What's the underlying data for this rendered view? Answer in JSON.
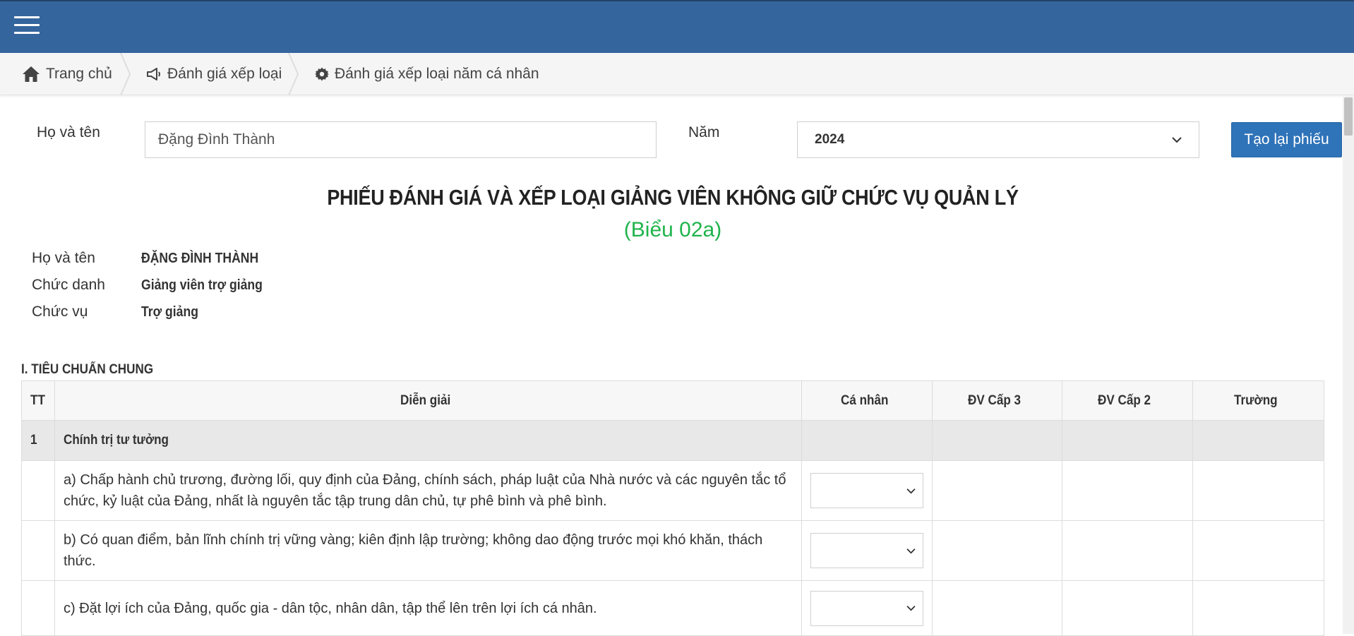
{
  "breadcrumb": {
    "home": "Trang chủ",
    "evaluation": "Đánh giá xếp loại",
    "current": "Đánh giá xếp loại năm cá nhân"
  },
  "form": {
    "name_label": "Họ và tên",
    "name_value": "Đặng Đình Thành",
    "year_label": "Năm",
    "year_value": "2024",
    "regenerate_label": "Tạo lại phiếu"
  },
  "sheet": {
    "title": "PHIẾU ĐÁNH GIÁ VÀ XẾP LOẠI GIẢNG VIÊN KHÔNG GIỮ CHỨC VỤ QUẢN LÝ",
    "subtitle": "(Biểu 02a)",
    "info": [
      {
        "label": "Họ và tên",
        "value": "ĐẶNG ĐÌNH THÀNH"
      },
      {
        "label": "Chức danh",
        "value": "Giảng viên trợ giảng"
      },
      {
        "label": "Chức vụ",
        "value": "Trợ giảng"
      }
    ]
  },
  "section_title": "I. TIÊU CHUẨN CHUNG",
  "table": {
    "headers": [
      "TT",
      "Diễn giải",
      "Cá nhân",
      "ĐV Cấp 3",
      "ĐV Cấp 2",
      "Trường"
    ],
    "group": {
      "num": "1",
      "label": "Chính trị tư tưởng"
    },
    "rows": [
      {
        "text": "a) Chấp hành chủ trương, đường lối, quy định của Đảng, chính sách, pháp luật của Nhà nước và các nguyên tắc tổ chức, kỷ luật của Đảng, nhất là nguyên tắc tập trung dân chủ, tự phê bình và phê bình."
      },
      {
        "text": "b) Có quan điểm, bản lĩnh chính trị vững vàng; kiên định lập trường; không dao động trước mọi khó khăn, thách thức."
      },
      {
        "text": "c) Đặt lợi ích của Đảng, quốc gia - dân tộc, nhân dân, tập thể lên trên lợi ích cá nhân."
      }
    ]
  },
  "colors": {
    "topbar": "#35659d",
    "button": "#2f73b8",
    "subtitle": "#1fb44c"
  },
  "icons": [
    "menu-icon",
    "home-icon",
    "megaphone-icon",
    "gear-icon",
    "chevron-down-icon"
  ]
}
